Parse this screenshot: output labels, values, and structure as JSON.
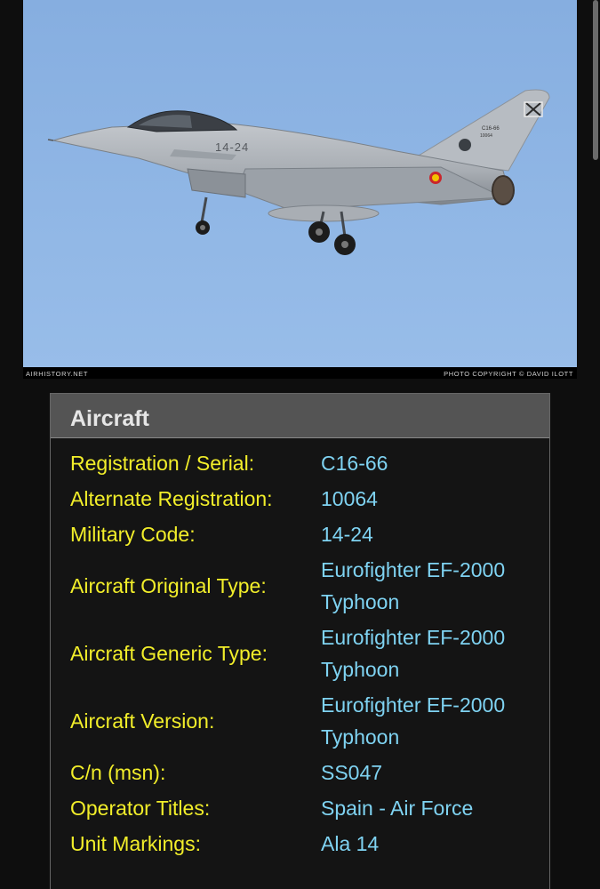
{
  "photo": {
    "alt": "Eurofighter EF-2000 Typhoon in flight",
    "fuselage_code": "14-24",
    "tail_code": "C16-66",
    "tail_serial": "10064",
    "credit_left": "AirHistory.net",
    "credit_right": "Photo Copyright © David Ilott",
    "sky_color": "#8db4e3"
  },
  "panel": {
    "title": "Aircraft",
    "rows": [
      {
        "label": "Registration / Serial:",
        "value": "C16-66"
      },
      {
        "label": "Alternate Registration:",
        "value": "10064"
      },
      {
        "label": "Military Code:",
        "value": "14-24"
      },
      {
        "label": "Aircraft Original Type:",
        "value": "Eurofighter EF-2000 Typhoon"
      },
      {
        "label": "Aircraft Generic Type:",
        "value": "Eurofighter EF-2000 Typhoon"
      },
      {
        "label": "Aircraft Version:",
        "value": "Eurofighter EF-2000 Typhoon"
      },
      {
        "label": "C/n (msn):",
        "value": "SS047"
      },
      {
        "label": "Operator Titles:",
        "value": "Spain - Air Force"
      },
      {
        "label": "Unit Markings:",
        "value": "Ala 14"
      }
    ]
  },
  "colors": {
    "label": "#f2ee2a",
    "value": "#7fd3f2",
    "header_bg": "#545454",
    "background": "#0e0e0e"
  }
}
